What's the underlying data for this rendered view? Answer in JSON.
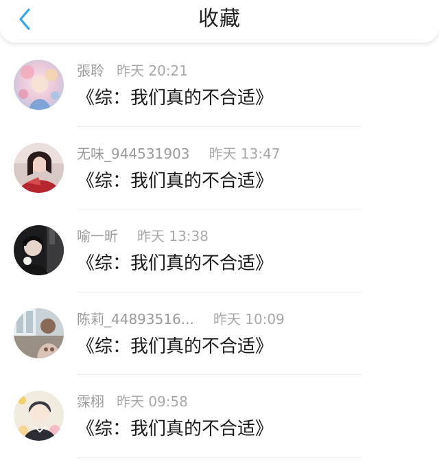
{
  "header": {
    "title": "收藏",
    "back_icon": "chevron-left-icon",
    "accent_color": "#2aa3f0"
  },
  "items": [
    {
      "name": "張聆",
      "time": "昨天 20:21",
      "content": "《综：我们真的不合适》",
      "avatar": "illustrated-girl-floral"
    },
    {
      "name": "无味_944531903",
      "time": "昨天 13:47",
      "content": "《综：我们真的不合适》",
      "avatar": "girl-in-red"
    },
    {
      "name": "喻一昕",
      "time": "昨天 13:38",
      "content": "《综：我们真的不合适》",
      "avatar": "dark-portrait"
    },
    {
      "name": "陈莉_44893516...",
      "time": "昨天 10:09",
      "content": "《综：我们真的不合适》",
      "avatar": "room-scene"
    },
    {
      "name": "霂栩",
      "time": "昨天 09:58",
      "content": "《综：我们真的不合适》",
      "avatar": "anime-boy-flowers"
    }
  ]
}
